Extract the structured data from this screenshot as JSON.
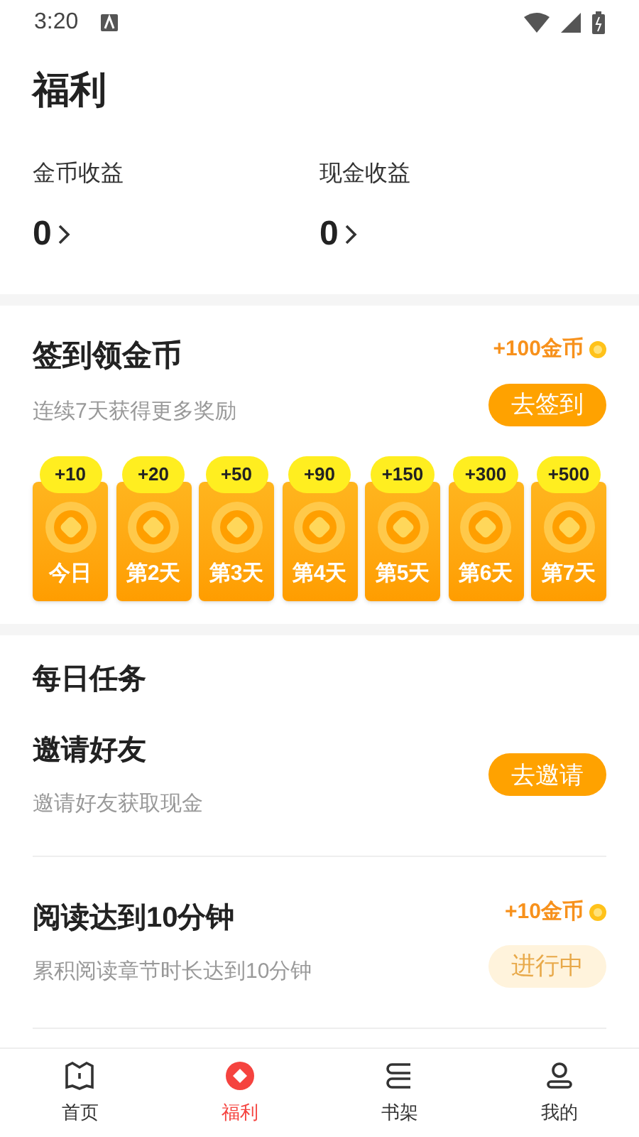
{
  "status_bar": {
    "time": "3:20"
  },
  "page_title": "福利",
  "earnings": [
    {
      "label": "金币收益",
      "value": "0"
    },
    {
      "label": "现金收益",
      "value": "0"
    }
  ],
  "checkin": {
    "title": "签到领金币",
    "subtitle": "连续7天获得更多奖励",
    "reward": "+100金币",
    "button": "去签到",
    "days": [
      {
        "bonus": "+10",
        "label": "今日"
      },
      {
        "bonus": "+20",
        "label": "第2天"
      },
      {
        "bonus": "+50",
        "label": "第3天"
      },
      {
        "bonus": "+90",
        "label": "第4天"
      },
      {
        "bonus": "+150",
        "label": "第5天"
      },
      {
        "bonus": "+300",
        "label": "第6天"
      },
      {
        "bonus": "+500",
        "label": "第7天"
      }
    ]
  },
  "daily_tasks": {
    "title": "每日任务",
    "tasks": [
      {
        "title": "邀请好友",
        "subtitle": "邀请好友获取现金",
        "button": "去邀请",
        "disabled": false
      },
      {
        "title": "阅读达到10分钟",
        "subtitle": "累积阅读章节时长达到10分钟",
        "reward": "+10金币",
        "button": "进行中",
        "disabled": true
      }
    ]
  },
  "bottom_nav": [
    {
      "label": "首页",
      "kind": "home",
      "selected": false
    },
    {
      "label": "福利",
      "kind": "welfare",
      "selected": true
    },
    {
      "label": "书架",
      "kind": "shelf",
      "selected": false
    },
    {
      "label": "我的",
      "kind": "me",
      "selected": false
    }
  ]
}
